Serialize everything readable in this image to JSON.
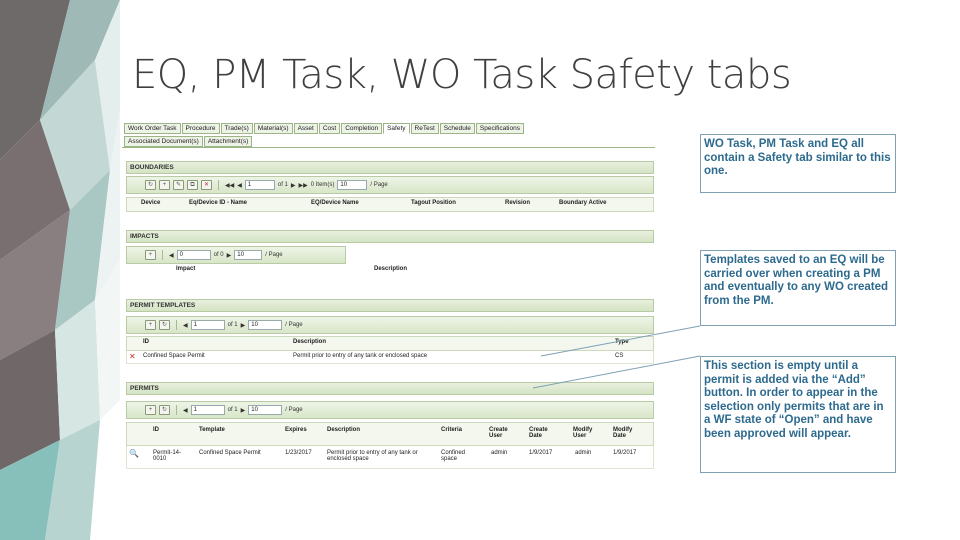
{
  "slide": {
    "title": "EQ, PM Task, WO Task Safety tabs"
  },
  "tabs": {
    "row1": [
      "Work Order Task",
      "Procedure",
      "Trade(s)",
      "Material(s)",
      "Asset",
      "Cost",
      "Completion",
      "Safety",
      "ReTest",
      "Schedule",
      "Specifications"
    ],
    "row2": [
      "Associated Document(s)",
      "Attachment(s)"
    ],
    "active": "Safety"
  },
  "boundaries": {
    "title": "BOUNDARIES",
    "pager": {
      "page": "1",
      "of": "of 1",
      "items": "0 Item(s)",
      "size": "10",
      "per_page": "/ Page"
    },
    "columns": [
      "Device",
      "Eq/Device ID - Name",
      "EQ/Device Name",
      "Tagout Position",
      "Revision",
      "Boundary Active"
    ]
  },
  "impacts": {
    "title": "IMPACTS",
    "pager": {
      "page": "0",
      "of": "of 0",
      "size": "10",
      "per_page": "/ Page"
    },
    "columns": [
      "Impact",
      "Description"
    ]
  },
  "permit_templates": {
    "title": "PERMIT TEMPLATES",
    "pager": {
      "page": "1",
      "of": "of 1",
      "size": "10",
      "per_page": "/ Page"
    },
    "columns": [
      "ID",
      "Description",
      "Type"
    ],
    "rows": [
      {
        "id": "Confined Space Permit",
        "description": "Permit prior to entry of any tank or enclosed space",
        "type": "CS"
      }
    ]
  },
  "permits": {
    "title": "PERMITS",
    "pager": {
      "page": "1",
      "of": "of 1",
      "size": "10",
      "per_page": "/ Page"
    },
    "columns": [
      "ID",
      "Template",
      "Expires",
      "Description",
      "Criteria",
      "Create User",
      "Create Date",
      "Modify User",
      "Modify Date"
    ],
    "rows": [
      {
        "id": "Permit-14-0010",
        "template": "Confined Space Permit",
        "expires": "1/23/2017",
        "description": "Permit prior to entry of any tank or enclosed space",
        "criteria": "Confined space",
        "create_user": "admin",
        "create_date": "1/9/2017",
        "modify_user": "admin",
        "modify_date": "1/9/2017"
      }
    ]
  },
  "callouts": {
    "c1": "WO Task, PM Task and EQ all contain a Safety tab similar to this one.",
    "c2": "Templates saved to an EQ will be carried over when creating a PM and eventually to any WO created from the PM.",
    "c3": "This section is empty until a permit is added via the “Add” button. In order to appear in the selection only permits that are in a WF state of “Open” and have been approved will appear."
  },
  "colors": {
    "accent": "#2d6a8e",
    "header_green": "#d4e3c4"
  }
}
